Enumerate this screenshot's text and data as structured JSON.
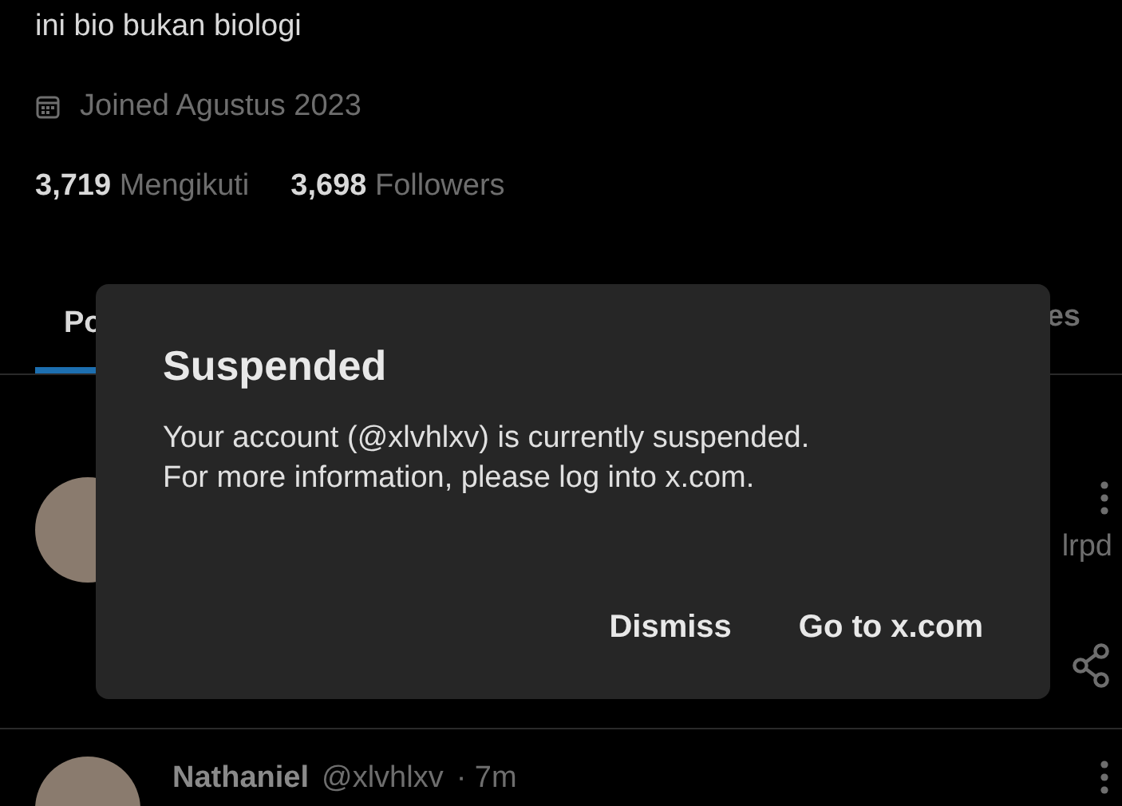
{
  "profile": {
    "bio": "ini bio bukan biologi",
    "joined": "Joined Agustus 2023",
    "following_count": "3,719",
    "following_label": "Mengikuti",
    "followers_count": "3,698",
    "followers_label": "Followers"
  },
  "tabs": [
    {
      "label": "Po",
      "selected": true
    },
    {
      "label": "es",
      "selected": false
    }
  ],
  "posts": [
    {
      "text_fragment": "lrpd"
    },
    {
      "name": "Nathaniel",
      "handle": "@xlvhlxv",
      "time": "· 7m"
    }
  ],
  "dialog": {
    "title": "Suspended",
    "message_lines": [
      "Your account (@xlvhlxv) is currently suspended.",
      "For more information, please log into x.com."
    ],
    "buttons": [
      "Dismiss",
      "Go to x.com"
    ]
  }
}
